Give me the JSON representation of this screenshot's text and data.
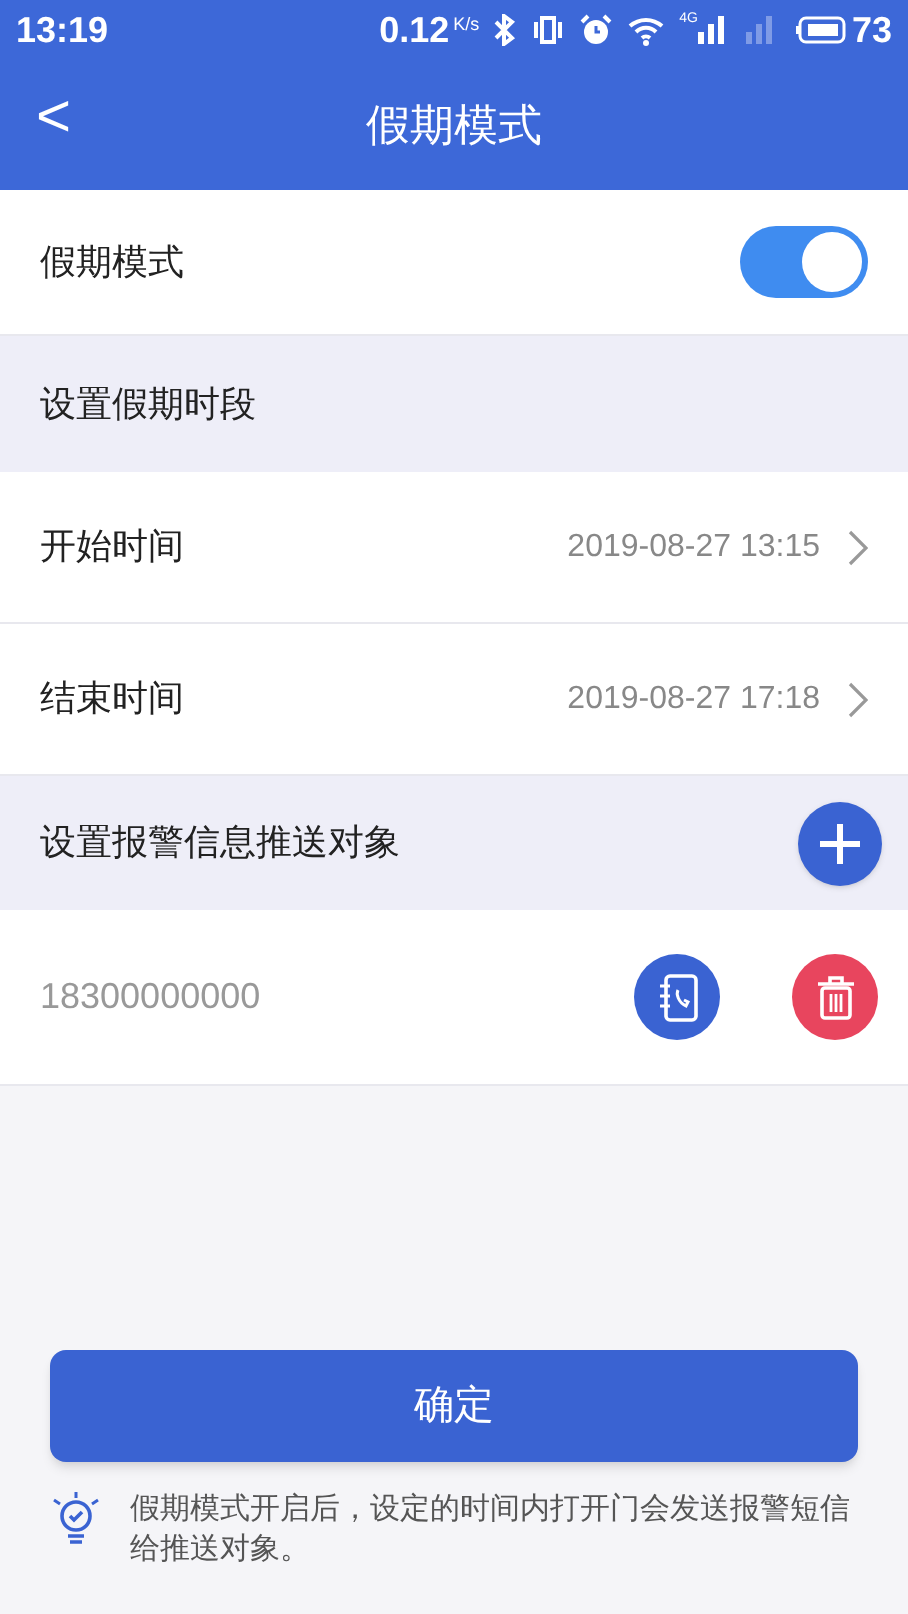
{
  "status_bar": {
    "time": "13:19",
    "speed": "0.12",
    "speed_unit": "K/s",
    "network": "4G",
    "battery": "73"
  },
  "header": {
    "back": "<",
    "title": "假期模式"
  },
  "toggle": {
    "label": "假期模式",
    "on": true
  },
  "period_section": {
    "title": "设置假期时段"
  },
  "times": [
    {
      "label": "开始时间",
      "value": "2019-08-27 13:15"
    },
    {
      "label": "结束时间",
      "value": "2019-08-27 17:18"
    }
  ],
  "recipients_section": {
    "title": "设置报警信息推送对象"
  },
  "recipients": [
    {
      "phone": "18300000000"
    }
  ],
  "confirm": "确定",
  "note": "假期模式开启后，设定的时间内打开门会发送报警短信给推送对象。"
}
